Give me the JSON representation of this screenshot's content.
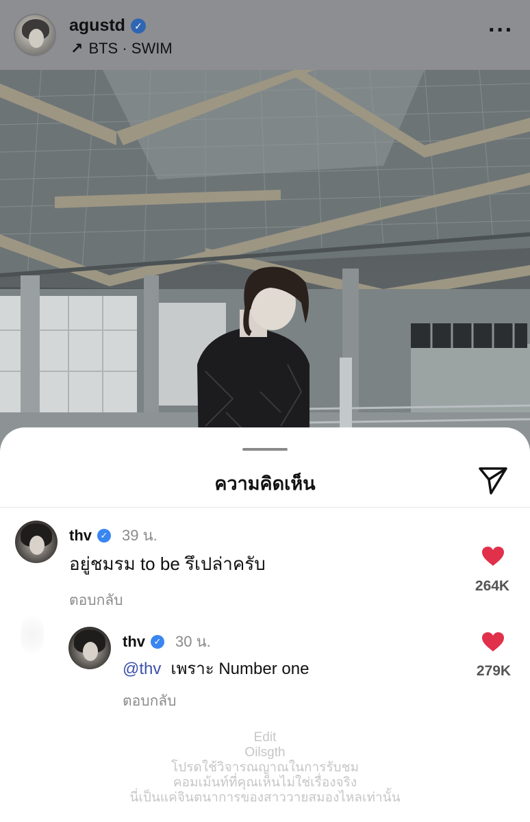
{
  "post": {
    "username": "agustd",
    "verified": true,
    "subtitle": "BTS · SWIM",
    "arrow_icon": "arrow-up-right-icon",
    "more_icon": "more-dots-icon"
  },
  "sheet": {
    "title": "ความคิดเห็น",
    "send_icon": "send-icon"
  },
  "comments": [
    {
      "username": "thv",
      "time": "39 น.",
      "text": "อยู่ชมรม to be รึเปล่าครับ",
      "reply_label": "ตอบกลับ",
      "likes": "264K"
    },
    {
      "username": "thv",
      "time": "30 น.",
      "mention": "@thv",
      "text": "เพราะ Number one",
      "reply_label": "ตอบกลับ",
      "likes": "279K"
    }
  ],
  "watermark": {
    "line1": "Edit",
    "line2": "Oilsgth",
    "line3": "โปรดใช้วิจารณญาณในการรับชม",
    "line4": "คอมเม้นท์ที่คุณเห็นไม่ใช่เรื่องจริง",
    "line5": "นี่เป็นแค่จินตนาการของสาววายสมองไหลเท่านั้น"
  },
  "colors": {
    "accent_heart": "#e0304a",
    "verified_blue": "#3a86f0",
    "mention": "#3c4fa8"
  }
}
